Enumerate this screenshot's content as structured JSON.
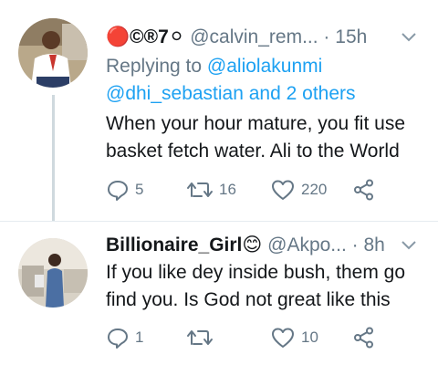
{
  "tweets": [
    {
      "display_name": "🔴©®7⚪",
      "handle": "@calvin_rem...",
      "dot": "·",
      "time": "15h",
      "replying_prefix": "Replying to ",
      "replying_user": "@aliolakunmi",
      "replying_more": "@dhi_sebastian and 2 others",
      "text_line1": "When your hour mature, you fit use",
      "text_line2": "basket fetch water. Ali to the World",
      "replies": "5",
      "retweets": "16",
      "likes": "220"
    },
    {
      "display_name": "Billionaire_Girl😊",
      "handle": "@Akpo...",
      "dot": "·",
      "time": "8h",
      "text_line1": "If you like dey inside bush, them go",
      "text_line2": "find you. Is God not great like this",
      "replies": "1",
      "retweets": "",
      "likes": "10"
    }
  ],
  "colors": {
    "link": "#1da1f2",
    "secondary": "#657786",
    "primary_text": "#14171a",
    "thread_line": "#cfd9de"
  },
  "icons": [
    "reply-icon",
    "retweet-icon",
    "like-icon",
    "share-icon",
    "chevron-down-icon"
  ]
}
